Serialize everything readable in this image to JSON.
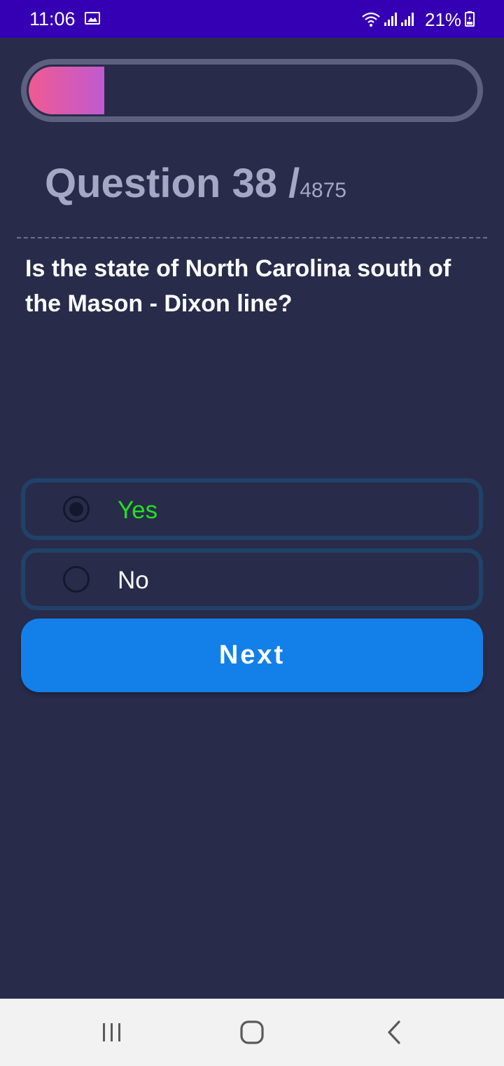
{
  "status_bar": {
    "time": "11:06",
    "battery": "21%",
    "icons": [
      "gallery-icon",
      "wifi-icon",
      "signal-icon",
      "signal-icon",
      "battery-charging-icon"
    ]
  },
  "progress": {
    "fraction": 0.17,
    "gradient": [
      "#f05a91",
      "#c05ad0"
    ]
  },
  "question": {
    "label": "Question 38 /",
    "total": "4875",
    "text": "Is the state of North Carolina south of the Mason - Dixon line?"
  },
  "options": [
    {
      "label": "Yes",
      "selected": true,
      "color": "#22e022"
    },
    {
      "label": "No",
      "selected": false,
      "color": "#ffffff"
    }
  ],
  "next_button": {
    "label": "Next",
    "color": "#1380ea"
  },
  "colors": {
    "background": "#282c4a",
    "status_bar": "#3500b3",
    "option_border": "#20426a"
  },
  "nav_bar": {
    "icons": [
      "recents-icon",
      "home-icon",
      "back-icon"
    ]
  }
}
